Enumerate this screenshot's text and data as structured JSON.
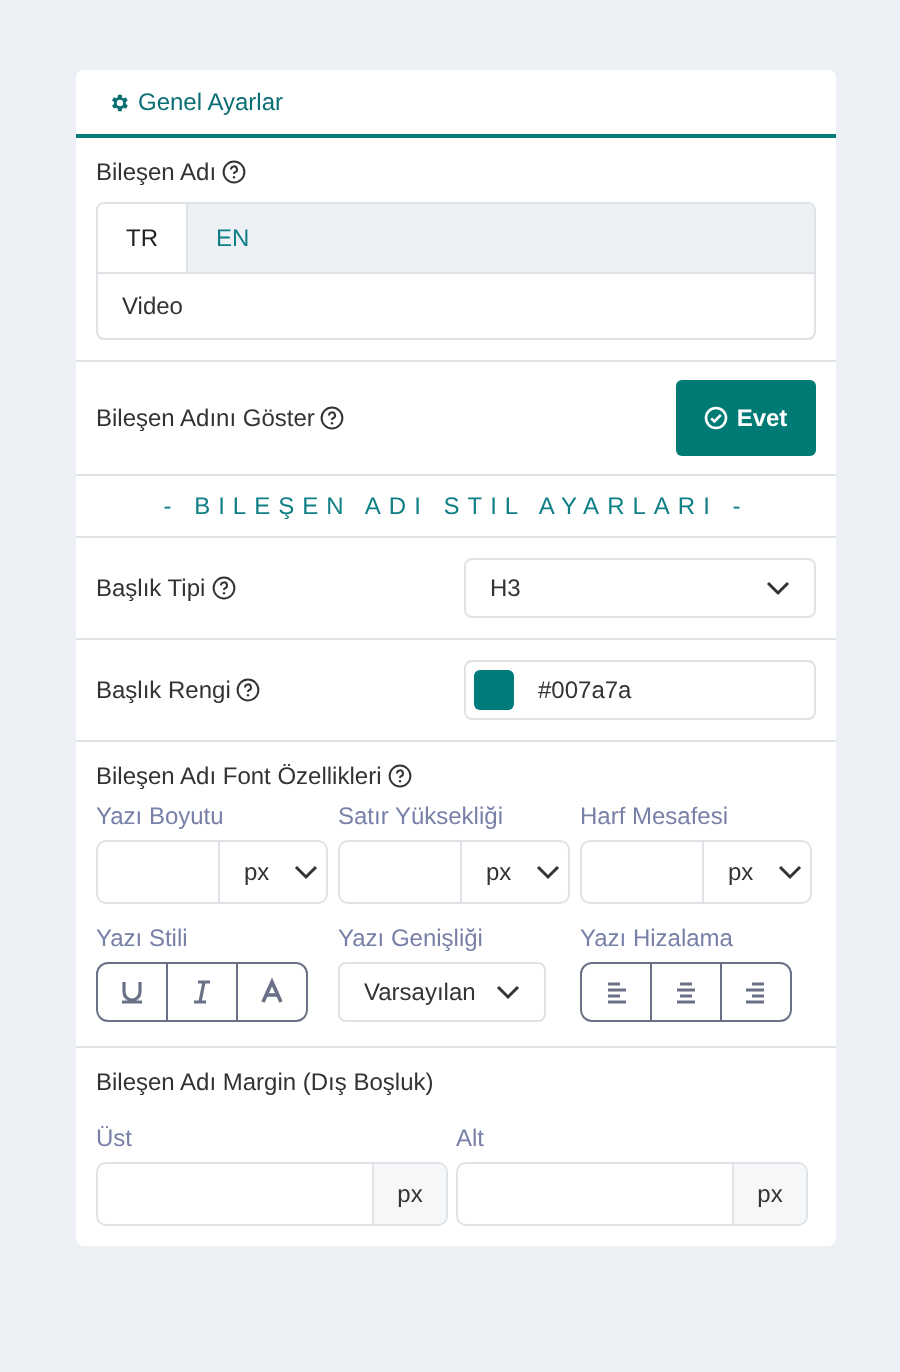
{
  "header": {
    "title": "Genel Ayarlar"
  },
  "name_field": {
    "label": "Bileşen Adı",
    "tabs": [
      {
        "label": "TR",
        "selected": true
      },
      {
        "label": "EN",
        "selected": false
      }
    ],
    "value": "Video"
  },
  "show_name": {
    "label": "Bileşen Adını Göster",
    "button": "Evet",
    "on": true
  },
  "section_title": "- BILEŞEN ADI STIL AYARLARI -",
  "heading_type": {
    "label": "Başlık Tipi",
    "value": "H3"
  },
  "heading_color": {
    "label": "Başlık Rengi",
    "value": "#007a7a"
  },
  "font": {
    "label": "Bileşen Adı Font Özellikleri",
    "sizes": [
      {
        "label": "Yazı Boyutu",
        "unit": "px"
      },
      {
        "label": "Satır Yüksekliği",
        "unit": "px"
      },
      {
        "label": "Harf Mesafesi",
        "unit": "px"
      }
    ],
    "style_label": "Yazı Stili",
    "width": {
      "label": "Yazı Genişliği",
      "value": "Varsayılan"
    },
    "align_label": "Yazı Hizalama"
  },
  "margin": {
    "label": "Bileşen Adı Margin (Dış Boşluk)",
    "fields": [
      {
        "label": "Üst",
        "unit": "px"
      },
      {
        "label": "Alt",
        "unit": "px"
      }
    ]
  }
}
